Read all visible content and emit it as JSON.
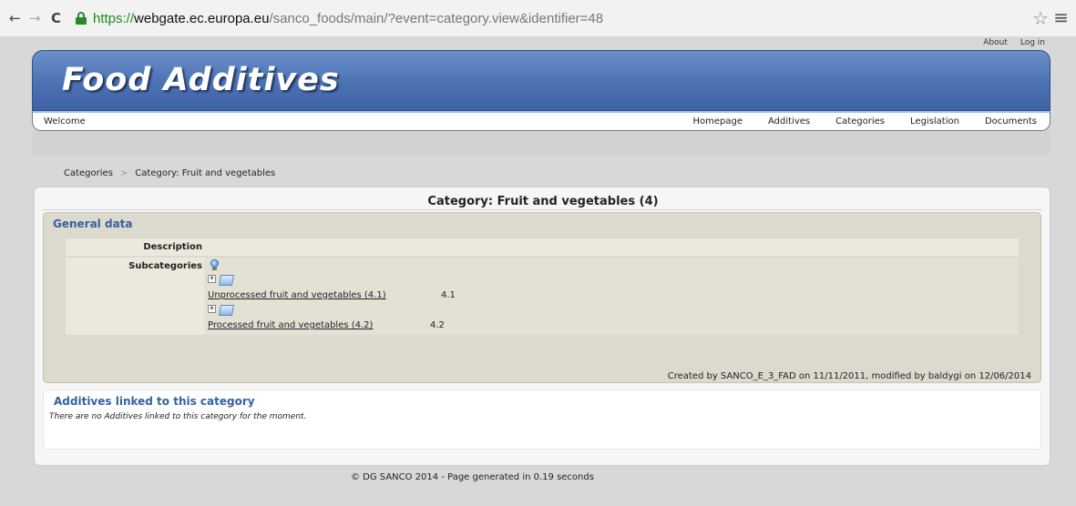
{
  "browser": {
    "back_icon": "←",
    "forward_icon": "→",
    "reload_icon": "C",
    "url_scheme": "https://",
    "url_host": "webgate.ec.europa.eu",
    "url_path": "/sanco_foods/main/?event=category.view&identifier=48",
    "star_icon": "☆",
    "menu_icon": "≡"
  },
  "top_links": {
    "about": "About",
    "login": "Log in"
  },
  "header": {
    "title": "Food Additives"
  },
  "menubar": {
    "welcome": "Welcome",
    "items": [
      "Homepage",
      "Additives",
      "Categories",
      "Legislation",
      "Documents"
    ]
  },
  "breadcrumb": {
    "root": "Categories",
    "sep": ">",
    "current": "Category: Fruit and vegetables"
  },
  "panel": {
    "title": "Category: Fruit and vegetables (4)"
  },
  "general": {
    "title": "General data",
    "description_label": "Description",
    "description_value": "",
    "subcategories_label": "Subcategories",
    "subcategories": [
      {
        "expand": "+",
        "label": "Unprocessed fruit and vegetables (4.1)",
        "code": "4.1"
      },
      {
        "expand": "+",
        "label": "Processed fruit and vegetables (4.2)",
        "code": "4.2"
      }
    ],
    "created": "Created by SANCO_E_3_FAD on 11/11/2011, modified by baldygi on 12/06/2014"
  },
  "additives": {
    "title": "Additives linked to this category",
    "message": "There are no Additives linked to this category for the moment."
  },
  "footer": "© DG SANCO 2014 - Page generated in 0.19 seconds",
  "colors": {
    "header": "#4c72b4",
    "section_title": "#3560a2",
    "general_bg": "#dcd9cd",
    "secure": "#1a8a1a"
  }
}
